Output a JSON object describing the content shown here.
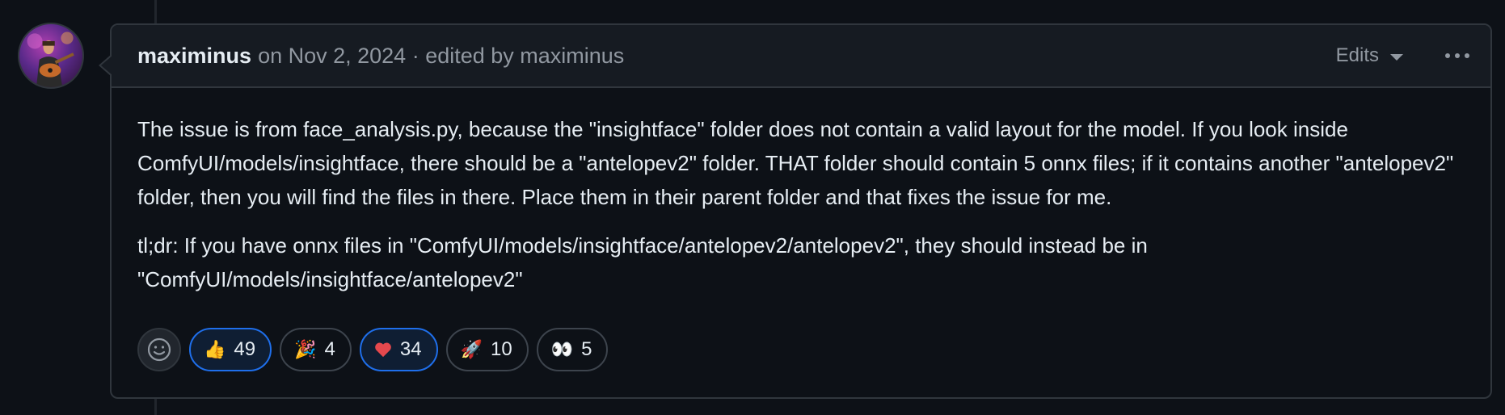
{
  "comment": {
    "author": "maximinus",
    "meta": "on Nov 2, 2024 · edited by maximinus",
    "edits_label": "Edits",
    "body": [
      "The issue is from face_analysis.py, because the \"insightface\" folder does not contain a valid layout for the model. If you look inside ComfyUI/models/insightface, there should be a \"antelopev2\" folder. THAT folder should contain 5 onnx files; if it contains another \"antelopev2\" folder, then you will find the files in there. Place them in their parent folder and that fixes the issue for me.",
      "tl;dr: If you have onnx files in \"ComfyUI/models/insightface/antelopev2/antelopev2\", they should instead be in \"ComfyUI/models/insightface/antelopev2\""
    ]
  },
  "reactions": [
    {
      "icon": "thumbs-up-icon",
      "glyph": "👍",
      "count": "49",
      "active": true
    },
    {
      "icon": "party-popper-icon",
      "glyph": "🎉",
      "count": "4",
      "active": false
    },
    {
      "icon": "heart-icon",
      "glyph": "❤️",
      "count": "34",
      "active": true
    },
    {
      "icon": "rocket-icon",
      "glyph": "🚀",
      "count": "10",
      "active": false
    },
    {
      "icon": "eyes-icon",
      "glyph": "👀",
      "count": "5",
      "active": false
    }
  ],
  "colors": {
    "background": "#0d1117",
    "header": "#161b22",
    "border": "#30363d",
    "muted_text": "#9198a1",
    "accent_blue": "#1f6feb"
  }
}
